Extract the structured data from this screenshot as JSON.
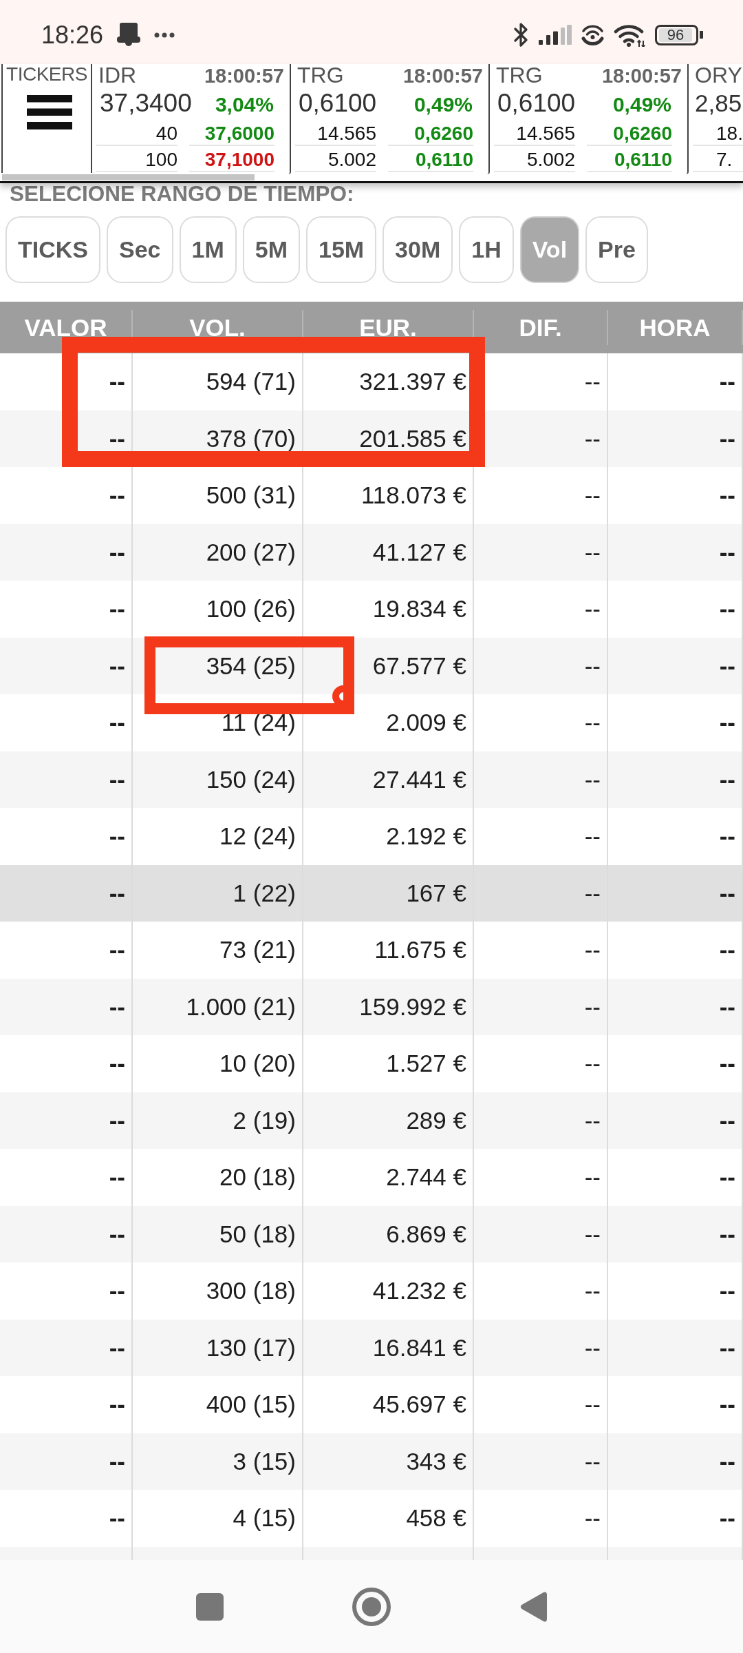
{
  "status_bar": {
    "time": "18:26",
    "battery": "96"
  },
  "tickers": {
    "label": "TICKERS",
    "cards": [
      {
        "symbol": "IDR",
        "time": "18:00:57",
        "price": "37,3400",
        "change": "3,04%",
        "color": "#138a13",
        "book": [
          {
            "volume": "40",
            "price": "37,6000",
            "color": "#138a13"
          },
          {
            "volume": "100",
            "price": "37,1000",
            "color": "#d01414"
          }
        ]
      },
      {
        "symbol": "TRG",
        "time": "18:00:57",
        "price": "0,6100",
        "change": "0,49%",
        "color": "#138a13",
        "book": [
          {
            "volume": "14.565",
            "price": "0,6260",
            "color": "#138a13"
          },
          {
            "volume": "5.002",
            "price": "0,6110",
            "color": "#138a13"
          }
        ]
      },
      {
        "symbol": "TRG",
        "time": "18:00:57",
        "price": "0,6100",
        "change": "0,49%",
        "color": "#138a13",
        "book": [
          {
            "volume": "14.565",
            "price": "0,6260",
            "color": "#138a13"
          },
          {
            "volume": "5.002",
            "price": "0,6110",
            "color": "#138a13"
          }
        ]
      },
      {
        "symbol": "ORY",
        "price": "2,85",
        "book": [
          {
            "volume": "18."
          },
          {
            "volume": "7."
          }
        ]
      }
    ]
  },
  "time_range": {
    "label": "SELECIONE RANGO DE TIEMPO:",
    "options": [
      {
        "label": "TICKS",
        "selected": false
      },
      {
        "label": "Sec",
        "selected": false
      },
      {
        "label": "1M",
        "selected": false
      },
      {
        "label": "5M",
        "selected": false
      },
      {
        "label": "15M",
        "selected": false
      },
      {
        "label": "30M",
        "selected": false
      },
      {
        "label": "1H",
        "selected": false
      },
      {
        "label": "Vol",
        "selected": true
      },
      {
        "label": "Pre",
        "selected": false
      }
    ]
  },
  "table": {
    "columns": [
      "VALOR",
      "VOL.",
      "EUR.",
      "DIF.",
      "HORA"
    ],
    "rows": [
      {
        "cells": [
          "--",
          "594 (71)",
          "321.397 €",
          "--",
          "--"
        ],
        "selected": false
      },
      {
        "cells": [
          "--",
          "378 (70)",
          "201.585 €",
          "--",
          "--"
        ],
        "selected": false
      },
      {
        "cells": [
          "--",
          "500 (31)",
          "118.073 €",
          "--",
          "--"
        ],
        "selected": false
      },
      {
        "cells": [
          "--",
          "200 (27)",
          "41.127 €",
          "--",
          "--"
        ],
        "selected": false
      },
      {
        "cells": [
          "--",
          "100 (26)",
          "19.834 €",
          "--",
          "--"
        ],
        "selected": false
      },
      {
        "cells": [
          "--",
          "354 (25)",
          "67.577 €",
          "--",
          "--"
        ],
        "selected": false
      },
      {
        "cells": [
          "--",
          "11 (24)",
          "2.009 €",
          "--",
          "--"
        ],
        "selected": false
      },
      {
        "cells": [
          "--",
          "150 (24)",
          "27.441 €",
          "--",
          "--"
        ],
        "selected": false
      },
      {
        "cells": [
          "--",
          "12 (24)",
          "2.192 €",
          "--",
          "--"
        ],
        "selected": false
      },
      {
        "cells": [
          "--",
          "1 (22)",
          "167 €",
          "--",
          "--"
        ],
        "selected": true
      },
      {
        "cells": [
          "--",
          "73 (21)",
          "11.675 €",
          "--",
          "--"
        ],
        "selected": false
      },
      {
        "cells": [
          "--",
          "1.000 (21)",
          "159.992 €",
          "--",
          "--"
        ],
        "selected": false
      },
      {
        "cells": [
          "--",
          "10 (20)",
          "1.527 €",
          "--",
          "--"
        ],
        "selected": false
      },
      {
        "cells": [
          "--",
          "2 (19)",
          "289 €",
          "--",
          "--"
        ],
        "selected": false
      },
      {
        "cells": [
          "--",
          "20 (18)",
          "2.744 €",
          "--",
          "--"
        ],
        "selected": false
      },
      {
        "cells": [
          "--",
          "50 (18)",
          "6.869 €",
          "--",
          "--"
        ],
        "selected": false
      },
      {
        "cells": [
          "--",
          "300 (18)",
          "41.232 €",
          "--",
          "--"
        ],
        "selected": false
      },
      {
        "cells": [
          "--",
          "130 (17)",
          "16.841 €",
          "--",
          "--"
        ],
        "selected": false
      },
      {
        "cells": [
          "--",
          "400 (15)",
          "45.697 €",
          "--",
          "--"
        ],
        "selected": false
      },
      {
        "cells": [
          "--",
          "3 (15)",
          "343 €",
          "--",
          "--"
        ],
        "selected": false
      },
      {
        "cells": [
          "--",
          "4 (15)",
          "458 €",
          "--",
          "--"
        ],
        "selected": false
      }
    ]
  },
  "annotations": [
    {
      "kind": "rectangle"
    },
    {
      "kind": "rectangle"
    }
  ]
}
